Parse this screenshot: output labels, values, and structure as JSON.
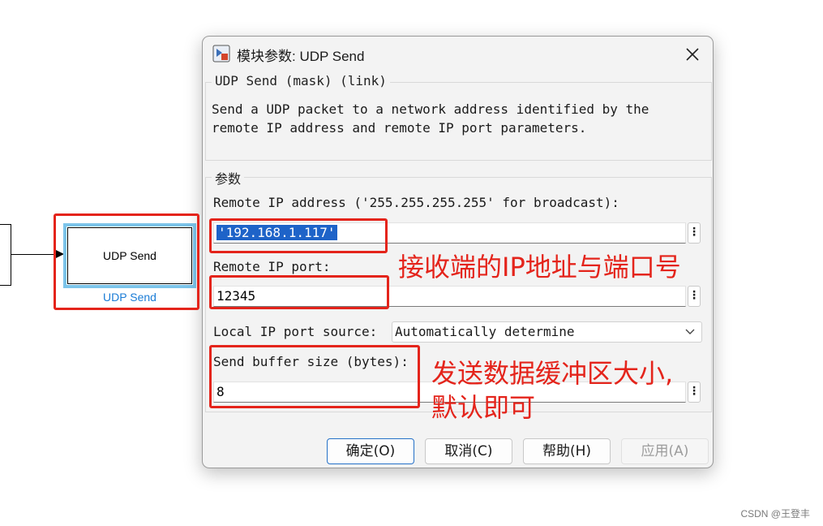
{
  "canvas": {
    "block_label": "UDP Send",
    "block_caption": "UDP Send"
  },
  "dialog": {
    "title": "模块参数: UDP Send",
    "block_group_title": "UDP Send (mask) (link)",
    "description": "Send a UDP packet to a network address identified by the\nremote IP address and remote IP port parameters.",
    "params_group_title": "参数",
    "remote_ip_label": "Remote IP address ('255.255.255.255' for broadcast):",
    "remote_ip_value": "'192.168.1.117'",
    "remote_port_label": "Remote IP port:",
    "remote_port_value": "12345",
    "local_port_label": "Local IP port source:",
    "local_port_value": "Automatically determine",
    "buffer_label": "Send buffer size (bytes):",
    "buffer_value": "8",
    "more_glyph": "⋮",
    "buttons": {
      "ok": "确定(O)",
      "cancel": "取消(C)",
      "help": "帮助(H)",
      "apply": "应用(A)"
    }
  },
  "annotations": {
    "ip_port_note": "接收端的IP地址与端口号",
    "buffer_note_line1": "发送数据缓冲区大小,",
    "buffer_note_line2": "默认即可"
  },
  "watermark": "CSDN @王登丰",
  "colors": {
    "annotation_red": "#e4241b",
    "block_highlight": "#7cc4ea",
    "caption_blue": "#1a7cd6",
    "selection_blue": "#1e63c8",
    "primary_border": "#2470c7"
  }
}
